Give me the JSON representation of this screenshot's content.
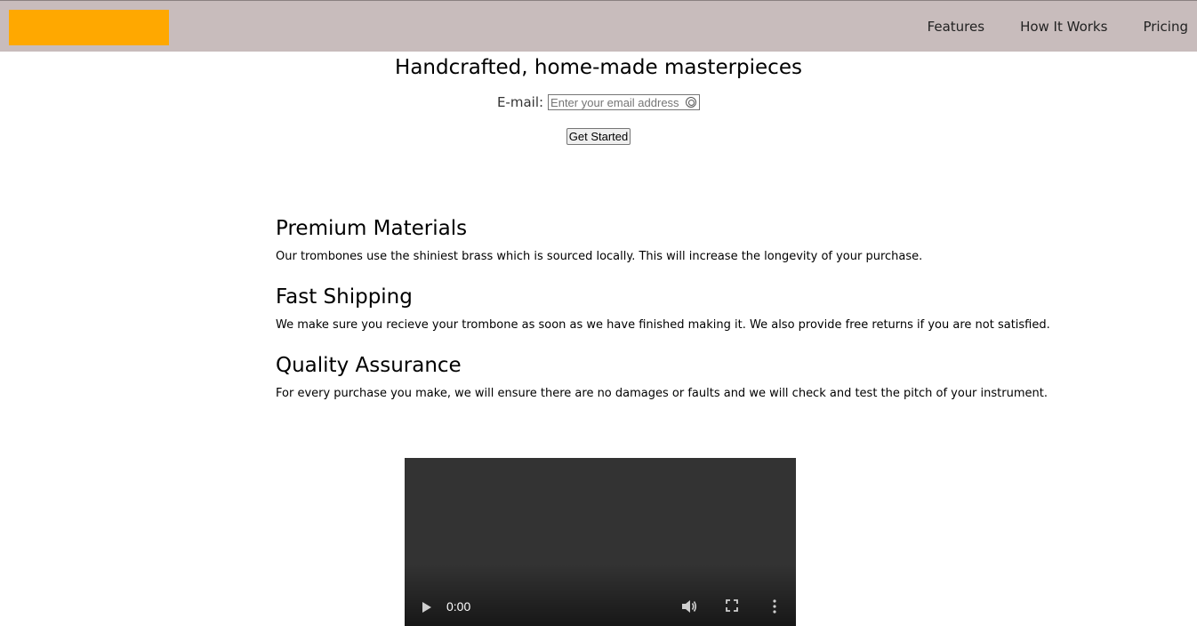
{
  "nav": {
    "items": [
      {
        "label": "Features"
      },
      {
        "label": "How It Works"
      },
      {
        "label": "Pricing"
      }
    ]
  },
  "brand": {
    "logo_color": "#ffa800",
    "header_bg": "#c8bcbc"
  },
  "hero": {
    "title": "Handcrafted, home-made masterpieces",
    "email_label": "E-mail:",
    "email_placeholder": "Enter your email address",
    "cta_label": "Get Started"
  },
  "features": [
    {
      "title": "Premium Materials",
      "text": "Our trombones use the shiniest brass which is sourced locally. This will increase the longevity of your purchase."
    },
    {
      "title": "Fast Shipping",
      "text": "We make sure you recieve your trombone as soon as we have finished making it. We also provide free returns if you are not satisfied."
    },
    {
      "title": "Quality Assurance",
      "text": "For every purchase you make, we will ensure there are no damages or faults and we will check and test the pitch of your instrument."
    }
  ],
  "video": {
    "time": "0:00",
    "icons": [
      "play-icon",
      "volume-icon",
      "fullscreen-icon",
      "more-options-icon"
    ]
  }
}
